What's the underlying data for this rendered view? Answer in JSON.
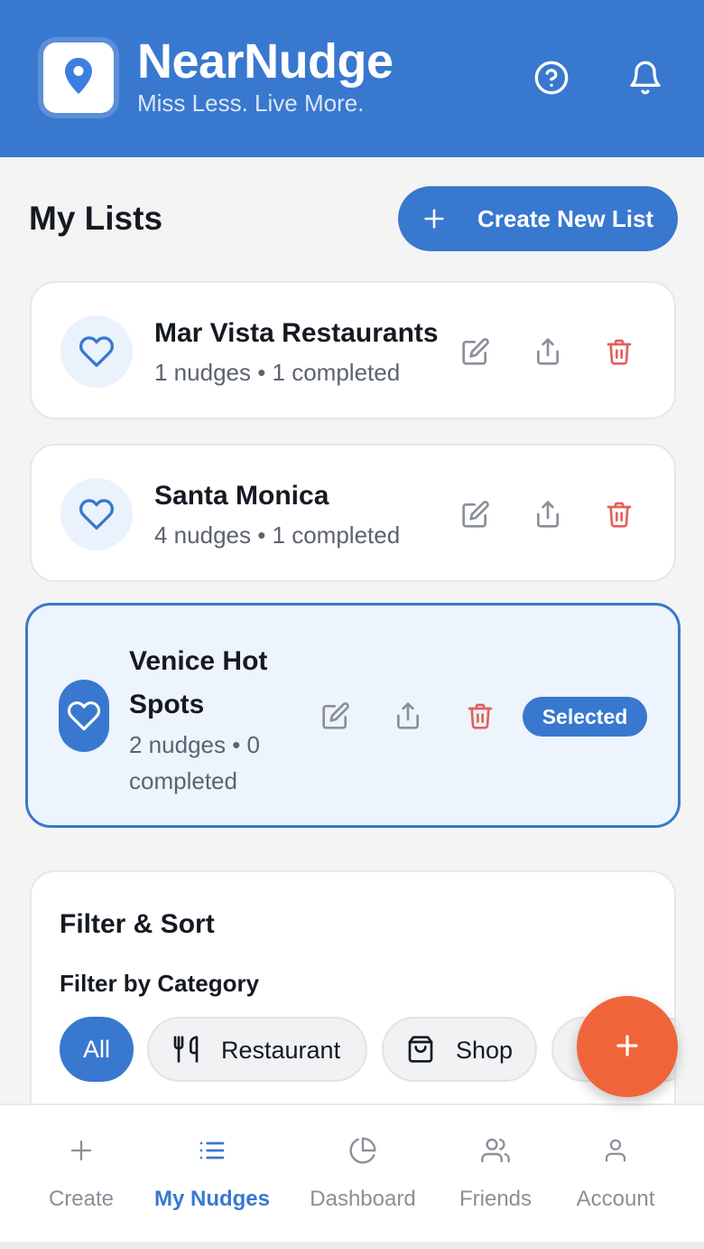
{
  "header": {
    "app_name": "NearNudge",
    "tagline": "Miss Less. Live More.",
    "logo_icon": "map-pin-icon",
    "help_icon": "help-circle-icon",
    "notifications_icon": "bell-icon",
    "brand_color": "#3878cf"
  },
  "lists_section": {
    "title": "My Lists",
    "create_button_label": "Create New List"
  },
  "lists": [
    {
      "name": "Mar Vista Restaurants",
      "meta": "1 nudges • 1 completed",
      "icon": "heart-icon",
      "selected": false
    },
    {
      "name": "Santa Monica",
      "meta": "4 nudges • 1 completed",
      "icon": "heart-icon",
      "selected": false
    },
    {
      "name": "Venice Hot Spots",
      "meta": "2 nudges • 0 completed",
      "icon": "heart-icon",
      "selected": true,
      "badge": "Selected"
    }
  ],
  "filter": {
    "title": "Filter & Sort",
    "category_label": "Filter by Category",
    "chips": [
      {
        "label": "All",
        "icon": "",
        "active": true
      },
      {
        "label": "Restaurant",
        "icon": "fork-knife-icon",
        "active": false
      },
      {
        "label": "Shop",
        "icon": "shopping-bag-icon",
        "active": false
      }
    ]
  },
  "fab_icon": "plus-icon",
  "fab_color": "#f0643a",
  "bottom_nav": [
    {
      "label": "Create",
      "icon": "plus-icon",
      "active": false
    },
    {
      "label": "My Nudges",
      "icon": "list-icon",
      "active": true
    },
    {
      "label": "Dashboard",
      "icon": "pie-chart-icon",
      "active": false
    },
    {
      "label": "Friends",
      "icon": "users-icon",
      "active": false
    },
    {
      "label": "Account",
      "icon": "user-icon",
      "active": false
    }
  ]
}
